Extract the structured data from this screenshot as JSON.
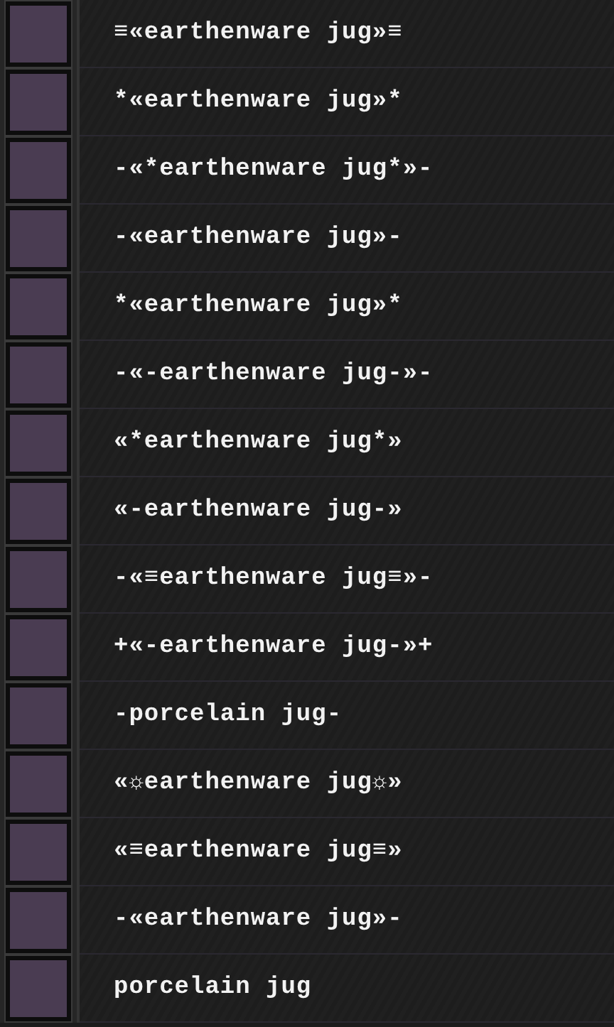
{
  "items": [
    {
      "name": "≡«earthenware jug»≡"
    },
    {
      "name": "*«earthenware jug»*"
    },
    {
      "name": "-«*earthenware jug*»-"
    },
    {
      "name": "-«earthenware jug»-"
    },
    {
      "name": "*«earthenware jug»*"
    },
    {
      "name": "-«-earthenware jug-»-"
    },
    {
      "name": "«*earthenware jug*»"
    },
    {
      "name": "«-earthenware jug-»"
    },
    {
      "name": "-«≡earthenware jug≡»-"
    },
    {
      "name": "+«-earthenware jug-»+"
    },
    {
      "name": "-porcelain jug-"
    },
    {
      "name": "«☼earthenware jug☼»"
    },
    {
      "name": "«≡earthenware jug≡»"
    },
    {
      "name": "-«earthenware jug»-"
    },
    {
      "name": "porcelain jug"
    }
  ]
}
